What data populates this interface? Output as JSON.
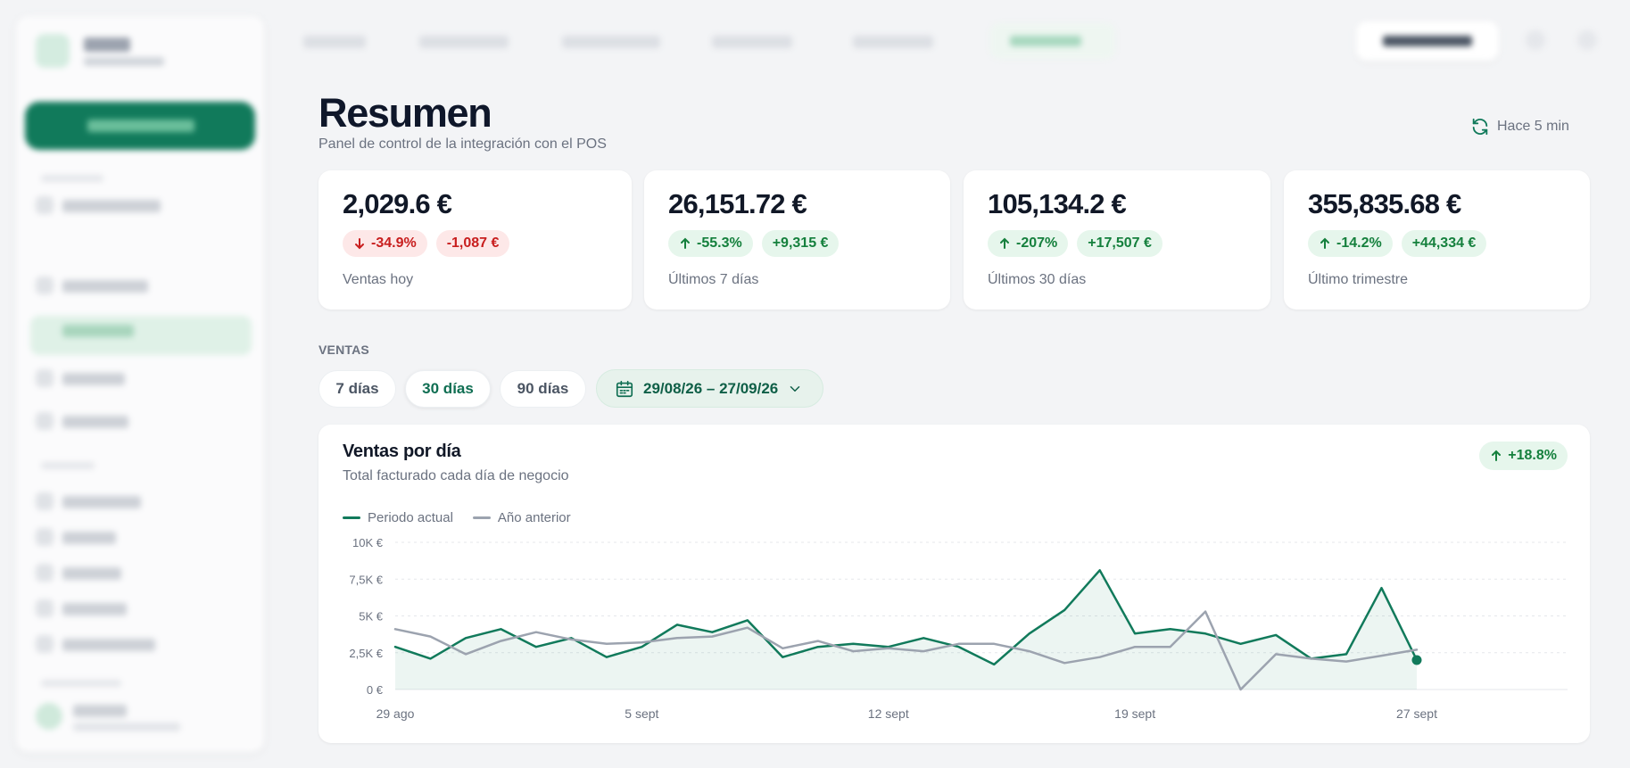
{
  "page": {
    "title": "Resumen",
    "subtitle": "Panel de control de la integración con el POS",
    "refresh_label": "Hace 5 min",
    "refresh_icon": "refresh-icon"
  },
  "kpis": [
    {
      "value": "2,029.6 €",
      "pct": "-34.9%",
      "delta": "-1,087 €",
      "direction": "down",
      "label": "Ventas hoy"
    },
    {
      "value": "26,151.72 €",
      "pct": "-55.3%",
      "delta": "+9,315 €",
      "direction": "up",
      "label": "Últimos 7 días"
    },
    {
      "value": "105,134.2 €",
      "pct": "-207%",
      "delta": "+17,507 €",
      "direction": "up",
      "label": "Últimos 30 días"
    },
    {
      "value": "355,835.68 €",
      "pct": "-14.2%",
      "delta": "+44,334 €",
      "direction": "up",
      "label": "Último trimestre"
    }
  ],
  "sales": {
    "section_title": "VENTAS",
    "ranges": [
      {
        "label": "7 días",
        "active": false
      },
      {
        "label": "30 días",
        "active": true
      },
      {
        "label": "90 días",
        "active": false
      }
    ],
    "date_range": "29/08/26 – 27/09/26"
  },
  "chart_card": {
    "title": "Ventas por día",
    "subtitle": "Total facturado cada día de negocio",
    "badge": "+18.8%"
  },
  "colors": {
    "primary": "#117a5b",
    "previous": "#9ca3af",
    "positive": "#15803d",
    "negative": "#c81e1e"
  },
  "chart_data": {
    "type": "line",
    "x": [
      "29 ago",
      "30 ago",
      "31 ago",
      "1 sept",
      "2 sept",
      "3 sept",
      "4 sept",
      "5 sept",
      "6 sept",
      "7 sept",
      "8 sept",
      "9 sept",
      "10 sept",
      "11 sept",
      "12 sept",
      "13 sept",
      "14 sept",
      "15 sept",
      "16 sept",
      "17 sept",
      "18 sept",
      "19 sept",
      "20 sept",
      "21 sept",
      "22 sept",
      "23 sept",
      "24 sept",
      "25 sept",
      "26 sept",
      "27 sept"
    ],
    "x_ticks": [
      "29 ago",
      "5 sept",
      "12 sept",
      "19 sept",
      "27 sept"
    ],
    "y_ticks": [
      "0 €",
      "2,5K €",
      "5K €",
      "7,5K €",
      "10K €"
    ],
    "ylim": [
      0,
      10000
    ],
    "grid": true,
    "legend_position": "top-left",
    "series": [
      {
        "name": "Periodo actual",
        "fill": true,
        "values": [
          2900,
          2100,
          3500,
          4100,
          2900,
          3500,
          2200,
          2900,
          4400,
          3900,
          4700,
          2200,
          2900,
          3100,
          2900,
          3500,
          2900,
          1700,
          3800,
          5400,
          8100,
          3800,
          4100,
          3800,
          3100,
          3700,
          2100,
          2400,
          6900,
          2000
        ]
      },
      {
        "name": "Año anterior",
        "fill": false,
        "values": [
          4100,
          3600,
          2400,
          3300,
          3900,
          3400,
          3100,
          3200,
          3500,
          3600,
          4200,
          2800,
          3300,
          2600,
          2800,
          2600,
          3100,
          3100,
          2600,
          1800,
          2200,
          2900,
          2900,
          5300,
          0,
          2400,
          2100,
          1900,
          2300,
          2700
        ]
      }
    ]
  }
}
